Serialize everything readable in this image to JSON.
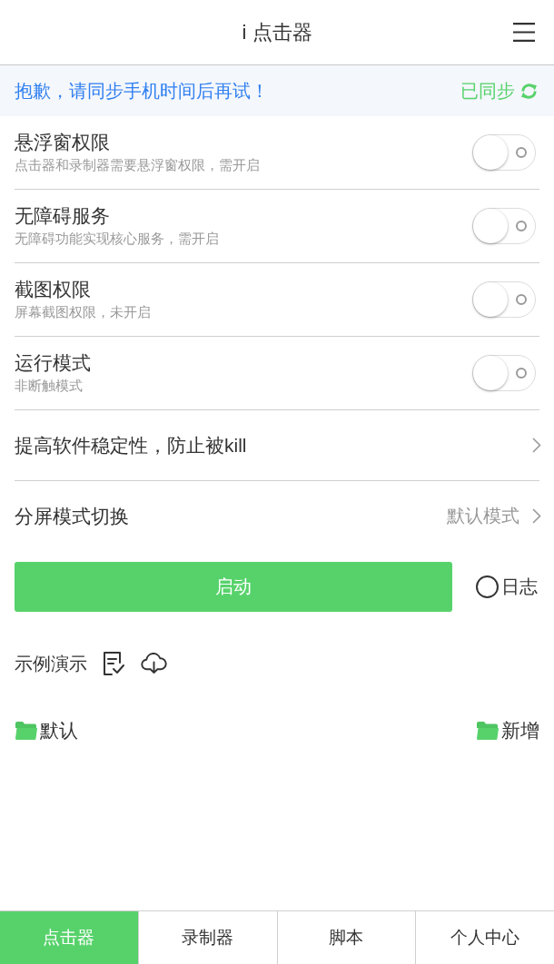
{
  "header": {
    "title": "i 点击器"
  },
  "banner": {
    "message": "抱歉，请同步手机时间后再试！",
    "sync_status": "已同步"
  },
  "settings": [
    {
      "kind": "toggle",
      "title": "悬浮窗权限",
      "subtitle": "点击器和录制器需要悬浮窗权限，需开启",
      "on": false
    },
    {
      "kind": "toggle",
      "title": "无障碍服务",
      "subtitle": "无障碍功能实现核心服务，需开启",
      "on": false
    },
    {
      "kind": "toggle",
      "title": "截图权限",
      "subtitle": "屏幕截图权限，未开启",
      "on": false
    },
    {
      "kind": "toggle",
      "title": "运行模式",
      "subtitle": "非断触模式",
      "on": false
    },
    {
      "kind": "link",
      "title": "提高软件稳定性，防止被kill"
    },
    {
      "kind": "link",
      "title": "分屏模式切换",
      "value": "默认模式"
    }
  ],
  "start_button": {
    "label": "启动"
  },
  "log_option": {
    "label": "日志",
    "checked": false
  },
  "examples": {
    "label": "示例演示"
  },
  "folder_bar": {
    "folder": "默认",
    "new_folder": "新增"
  },
  "tabs": [
    {
      "label": "点击器",
      "selected": true
    },
    {
      "label": "录制器",
      "selected": false
    },
    {
      "label": "脚本",
      "selected": false
    },
    {
      "label": "个人中心",
      "selected": false
    }
  ]
}
